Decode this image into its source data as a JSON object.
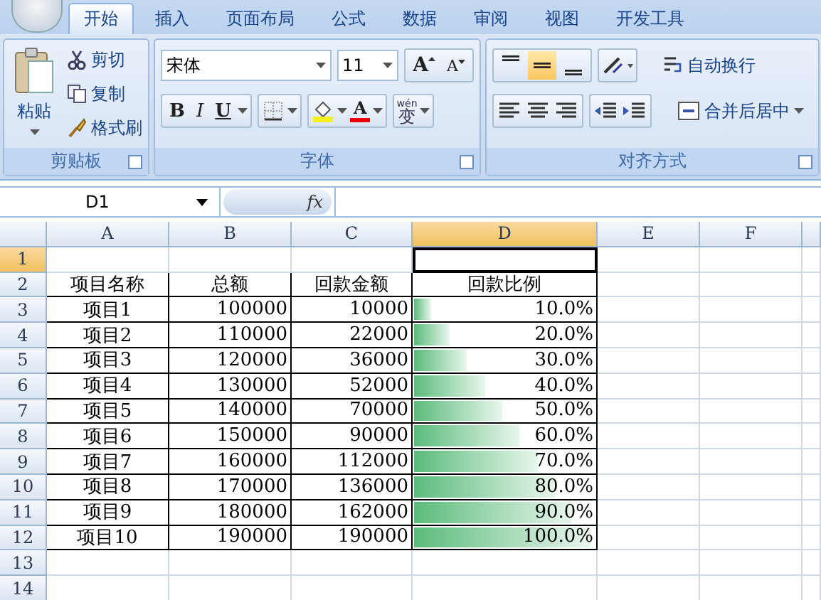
{
  "tabs": [
    {
      "label": "开始",
      "selected": true
    },
    {
      "label": "插入",
      "selected": false
    },
    {
      "label": "页面布局",
      "selected": false
    },
    {
      "label": "公式",
      "selected": false
    },
    {
      "label": "数据",
      "selected": false
    },
    {
      "label": "审阅",
      "selected": false
    },
    {
      "label": "视图",
      "selected": false
    },
    {
      "label": "开发工具",
      "selected": false
    }
  ],
  "clipboard": {
    "paste": "粘贴",
    "items": [
      "剪切",
      "复制",
      "格式刷"
    ],
    "label": "剪贴板"
  },
  "font": {
    "name": "宋体",
    "size": "11",
    "grow": "A",
    "shrink": "A",
    "styles": [
      "B",
      "I",
      "U"
    ],
    "color_letter": "A",
    "phonetic_top": "wén",
    "phonetic": "变",
    "label": "字体"
  },
  "alignment": {
    "vertical": [
      {
        "selected": false
      },
      {
        "selected": true
      },
      {
        "selected": false
      }
    ],
    "wrap": "自动换行",
    "merge": "合并后居中",
    "label": "对齐方式"
  },
  "name_box": "D1",
  "fx": "fx",
  "columns": [
    {
      "label": "A",
      "selected": false
    },
    {
      "label": "B",
      "selected": false
    },
    {
      "label": "C",
      "selected": false
    },
    {
      "label": "D",
      "selected": true
    },
    {
      "label": "E",
      "selected": false
    },
    {
      "label": "F",
      "selected": false
    }
  ],
  "rows": [
    {
      "number": "1",
      "selected": true,
      "kind": "blank",
      "cells": []
    },
    {
      "number": "2",
      "selected": false,
      "kind": "header",
      "cells": [
        {
          "text": "项目名称"
        },
        {
          "text": "总额"
        },
        {
          "text": "回款金额"
        },
        {
          "text": "回款比例"
        }
      ]
    },
    {
      "number": "3",
      "selected": false,
      "kind": "data",
      "cells": [
        {
          "text": "项目1"
        },
        {
          "text": "100000"
        },
        {
          "text": "10000"
        },
        {
          "text": "10.0%",
          "level": 0.1
        }
      ]
    },
    {
      "number": "4",
      "selected": false,
      "kind": "data",
      "cells": [
        {
          "text": "项目2"
        },
        {
          "text": "110000"
        },
        {
          "text": "22000"
        },
        {
          "text": "20.0%",
          "level": 0.2
        }
      ]
    },
    {
      "number": "5",
      "selected": false,
      "kind": "data",
      "cells": [
        {
          "text": "项目3"
        },
        {
          "text": "120000"
        },
        {
          "text": "36000"
        },
        {
          "text": "30.0%",
          "level": 0.3
        }
      ]
    },
    {
      "number": "6",
      "selected": false,
      "kind": "data",
      "cells": [
        {
          "text": "项目4"
        },
        {
          "text": "130000"
        },
        {
          "text": "52000"
        },
        {
          "text": "40.0%",
          "level": 0.4
        }
      ]
    },
    {
      "number": "7",
      "selected": false,
      "kind": "data",
      "cells": [
        {
          "text": "项目5"
        },
        {
          "text": "140000"
        },
        {
          "text": "70000"
        },
        {
          "text": "50.0%",
          "level": 0.5
        }
      ]
    },
    {
      "number": "8",
      "selected": false,
      "kind": "data",
      "cells": [
        {
          "text": "项目6"
        },
        {
          "text": "150000"
        },
        {
          "text": "90000"
        },
        {
          "text": "60.0%",
          "level": 0.6
        }
      ]
    },
    {
      "number": "9",
      "selected": false,
      "kind": "data",
      "cells": [
        {
          "text": "项目7"
        },
        {
          "text": "160000"
        },
        {
          "text": "112000"
        },
        {
          "text": "70.0%",
          "level": 0.7
        }
      ]
    },
    {
      "number": "10",
      "selected": false,
      "kind": "data",
      "cells": [
        {
          "text": "项目8"
        },
        {
          "text": "170000"
        },
        {
          "text": "136000"
        },
        {
          "text": "80.0%",
          "level": 0.8
        }
      ]
    },
    {
      "number": "11",
      "selected": false,
      "kind": "data",
      "cells": [
        {
          "text": "项目9"
        },
        {
          "text": "180000"
        },
        {
          "text": "162000"
        },
        {
          "text": "90.0%",
          "level": 0.9
        }
      ]
    },
    {
      "number": "12",
      "selected": false,
      "kind": "data",
      "cells": [
        {
          "text": "项目10"
        },
        {
          "text": "190000"
        },
        {
          "text": "190000"
        },
        {
          "text": "100.0%",
          "level": 1
        }
      ]
    },
    {
      "number": "13",
      "selected": false,
      "kind": "blank",
      "cells": []
    },
    {
      "number": "14",
      "selected": false,
      "kind": "blank",
      "cells": []
    }
  ]
}
